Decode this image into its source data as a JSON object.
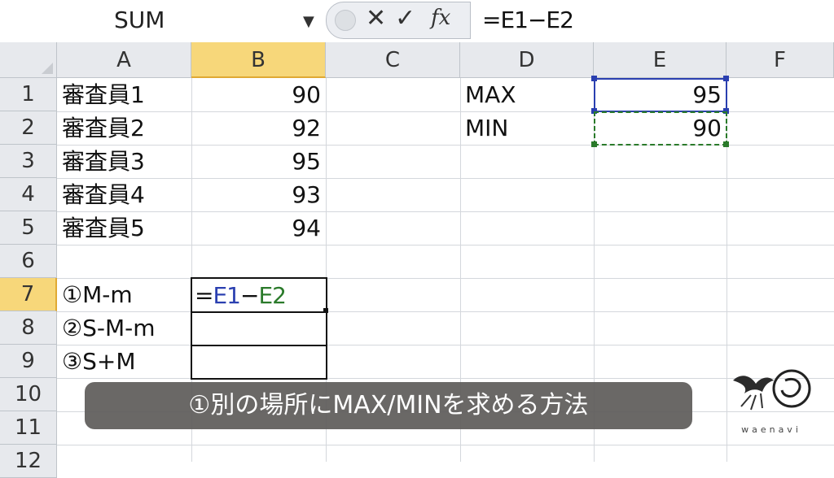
{
  "formula_bar": {
    "name_box": "SUM",
    "formula": "=E1−E2",
    "icons": [
      "cancel-icon",
      "enter-icon",
      "function-icon"
    ]
  },
  "columns": [
    "A",
    "B",
    "C",
    "D",
    "E",
    "F"
  ],
  "rows": [
    "1",
    "2",
    "3",
    "4",
    "5",
    "6",
    "7",
    "8",
    "9",
    "10",
    "11",
    "12"
  ],
  "cells": {
    "A1": "審査員1",
    "A2": "審査員2",
    "A3": "審査員3",
    "A4": "審査員4",
    "A5": "審査員5",
    "B1": "90",
    "B2": "92",
    "B3": "95",
    "B4": "93",
    "B5": "94",
    "D1": "MAX",
    "D2": "MIN",
    "E1": "95",
    "E2": "90",
    "A7": "①M-m",
    "A8": "②S-M-m",
    "A9": "③S+M"
  },
  "edit_cell": {
    "eq": "=",
    "ref1": "E1",
    "op": "−",
    "ref2": "E2"
  },
  "caption": "①別の場所にMAX/MINを求める方法",
  "logo_text": "waenavi",
  "colors": {
    "header_bg": "#e7e9ed",
    "selected_header": "#f7d77a",
    "ref1": "#2a3fb0",
    "ref2": "#2a7a2a"
  }
}
